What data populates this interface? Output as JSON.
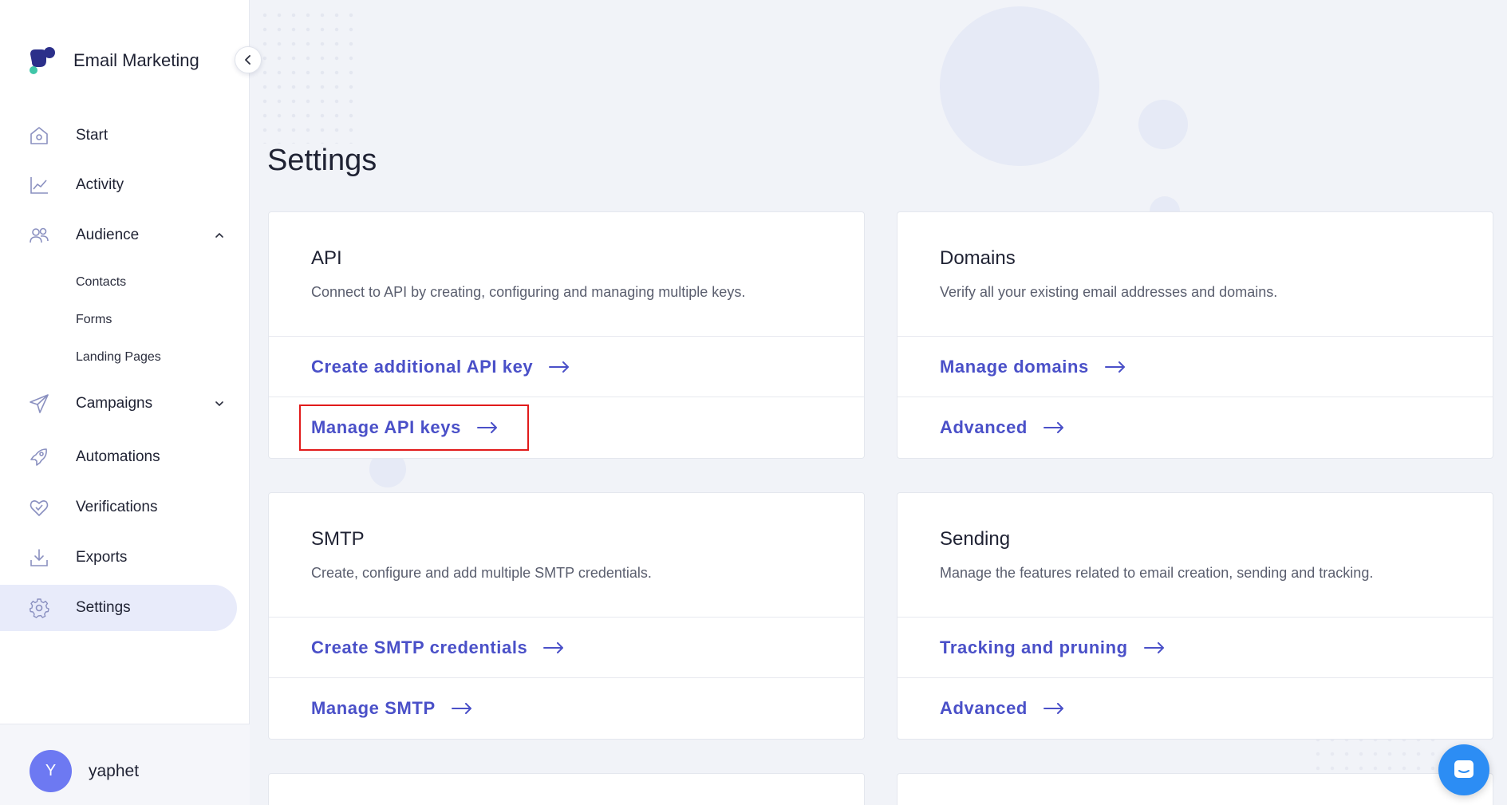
{
  "app": {
    "name": "Email Marketing"
  },
  "sidebar": {
    "items": [
      {
        "label": "Start",
        "icon": "home-icon"
      },
      {
        "label": "Activity",
        "icon": "chart-line-icon"
      },
      {
        "label": "Audience",
        "icon": "users-icon",
        "expanded": true,
        "children": [
          {
            "label": "Contacts"
          },
          {
            "label": "Forms"
          },
          {
            "label": "Landing Pages"
          }
        ]
      },
      {
        "label": "Campaigns",
        "icon": "paper-plane-icon",
        "expanded": false
      },
      {
        "label": "Automations",
        "icon": "rocket-icon"
      },
      {
        "label": "Verifications",
        "icon": "heart-check-icon"
      },
      {
        "label": "Exports",
        "icon": "download-icon"
      },
      {
        "label": "Settings",
        "icon": "gear-icon",
        "active": true
      }
    ],
    "user": {
      "initial": "Y",
      "name": "yaphet"
    }
  },
  "main": {
    "title": "Settings",
    "cards": [
      {
        "title": "API",
        "description": "Connect to API by creating, configuring and managing multiple keys.",
        "links": [
          "Create additional API key",
          "Manage API keys"
        ]
      },
      {
        "title": "Domains",
        "description": "Verify all your existing email addresses and domains.",
        "links": [
          "Manage domains",
          "Advanced"
        ]
      },
      {
        "title": "SMTP",
        "description": "Create, configure and add multiple SMTP credentials.",
        "links": [
          "Create SMTP credentials",
          "Manage SMTP"
        ]
      },
      {
        "title": "Sending",
        "description": "Manage the features related to email creation, sending and tracking.",
        "links": [
          "Tracking and pruning",
          "Advanced"
        ]
      }
    ]
  },
  "colors": {
    "accent": "#4a50c8",
    "highlight": "#e11b1b",
    "chat": "#2c8df4"
  }
}
